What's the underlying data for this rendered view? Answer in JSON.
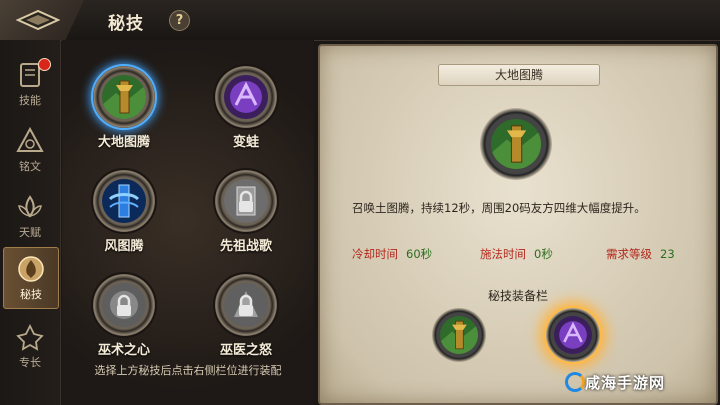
{
  "header": {
    "title": "秘技",
    "help": "?"
  },
  "sidebar": {
    "items": [
      {
        "label": "技能",
        "icon": "book-icon",
        "badge": true
      },
      {
        "label": "铭文",
        "icon": "rune-icon"
      },
      {
        "label": "天赋",
        "icon": "lotus-icon"
      },
      {
        "label": "秘技",
        "icon": "secret-skill-icon",
        "active": true
      },
      {
        "label": "专长",
        "icon": "specialty-icon"
      }
    ]
  },
  "skills": [
    {
      "name": "大地图腾",
      "icon": "earth-totem-icon",
      "selected": true
    },
    {
      "name": "变蛙",
      "icon": "frog-hex-icon"
    },
    {
      "name": "风图腾",
      "icon": "wind-totem-icon"
    },
    {
      "name": "先祖战歌",
      "icon": "ancestral-song-icon",
      "locked": true
    },
    {
      "name": "巫术之心",
      "icon": "witchcraft-heart-icon",
      "locked": true
    },
    {
      "name": "巫医之怒",
      "icon": "witchdoctor-rage-icon",
      "locked": true
    }
  ],
  "hint": "选择上方秘技后点击右侧栏位进行装配",
  "detail": {
    "title": "大地图腾",
    "description": "召唤土图腾，持续12秒，周围20码友方四维大幅度提升。",
    "cooldown_label": "冷却时间",
    "cooldown_value": "60秒",
    "cast_label": "施法时间",
    "cast_value": "0秒",
    "level_label": "需求等级",
    "level_value": "23",
    "equip_title": "秘技装备栏"
  },
  "watermark": "咸海手游网",
  "colors": {
    "accent": "#a27d4c",
    "selected_glow": "#3fa3ff",
    "slot_glow": "#ffb23a",
    "stat_key": "#b3281c",
    "stat_value": "#2b6e1e"
  }
}
